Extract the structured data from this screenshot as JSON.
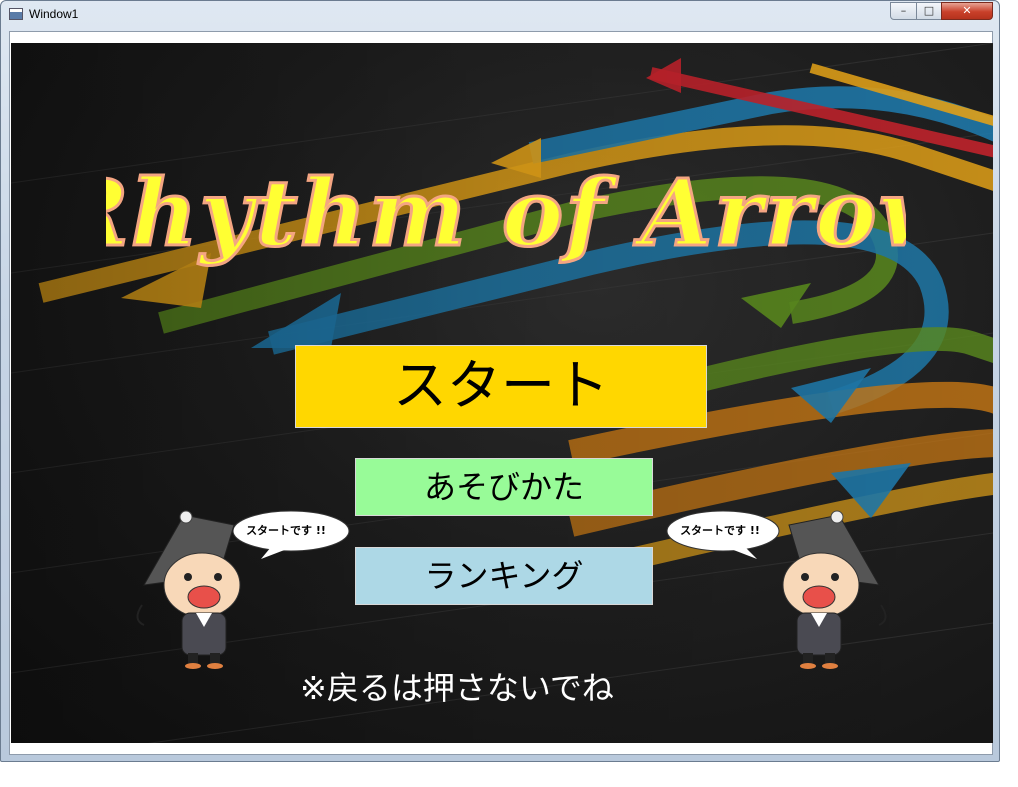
{
  "window": {
    "title": "Window1",
    "minimize_symbol": "–",
    "maximize_symbol": "□",
    "close_symbol": "✕"
  },
  "game": {
    "logo_text": "Rhythm of Arrow",
    "start_label": "スタート",
    "howto_label": "あそびかた",
    "ranking_label": "ランキング",
    "notice": "※戻るは押さないでね",
    "bubble_left": "スタートです !!",
    "bubble_right": "スタートです !!"
  },
  "colors": {
    "start": "#ffd700",
    "howto": "#98fb98",
    "ranking": "#add8e6",
    "logo_fill": "#ffff33",
    "logo_outline": "#f4a582",
    "arrows": [
      "#c0222b",
      "#e0a018",
      "#1f78a8",
      "#5a8a1e",
      "#c87814"
    ]
  }
}
